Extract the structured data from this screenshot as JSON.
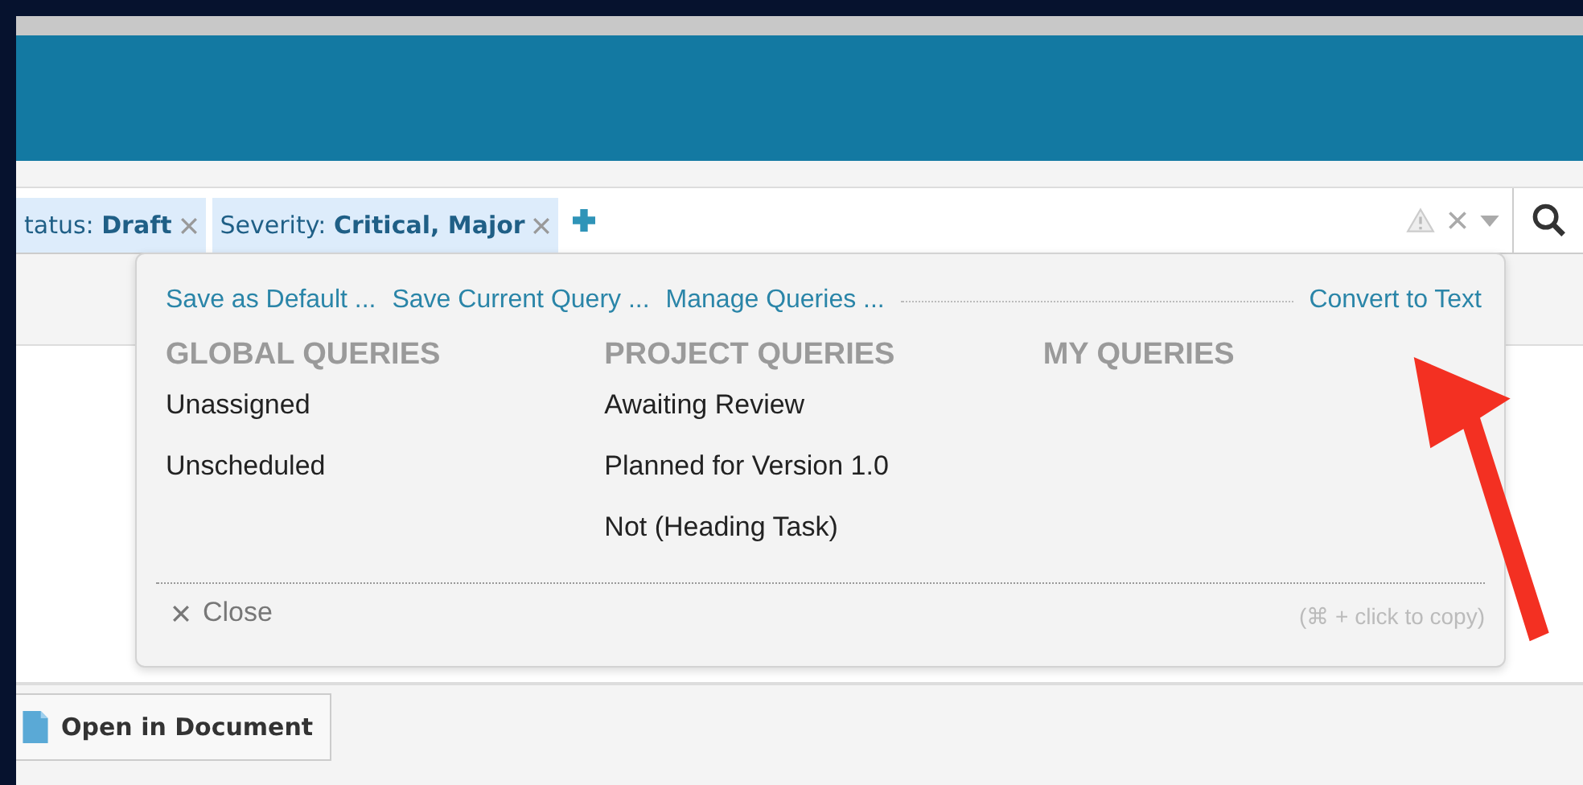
{
  "filters": [
    {
      "text": "tatus: **Draft**"
    },
    {
      "text": "Severity: **Critical, Major**"
    }
  ],
  "popup": {
    "actions": [
      {
        "label": "Save as Default ..."
      },
      {
        "label": "Save Current Query ..."
      },
      {
        "label": "Manage Queries ..."
      }
    ],
    "convert": "Convert to Text",
    "columns": [
      {
        "heading": "GLOBAL QUERIES",
        "items": [
          "Unassigned",
          "Unscheduled"
        ]
      },
      {
        "heading": "PROJECT QUERIES",
        "items": [
          "Awaiting Review",
          "Planned for Version 1.0",
          "Not (Heading Task)"
        ]
      },
      {
        "heading": "MY QUERIES"
      }
    ],
    "close": "Close",
    "hint": "(⌘ + click to copy)"
  },
  "footer_button": "Open in Document"
}
